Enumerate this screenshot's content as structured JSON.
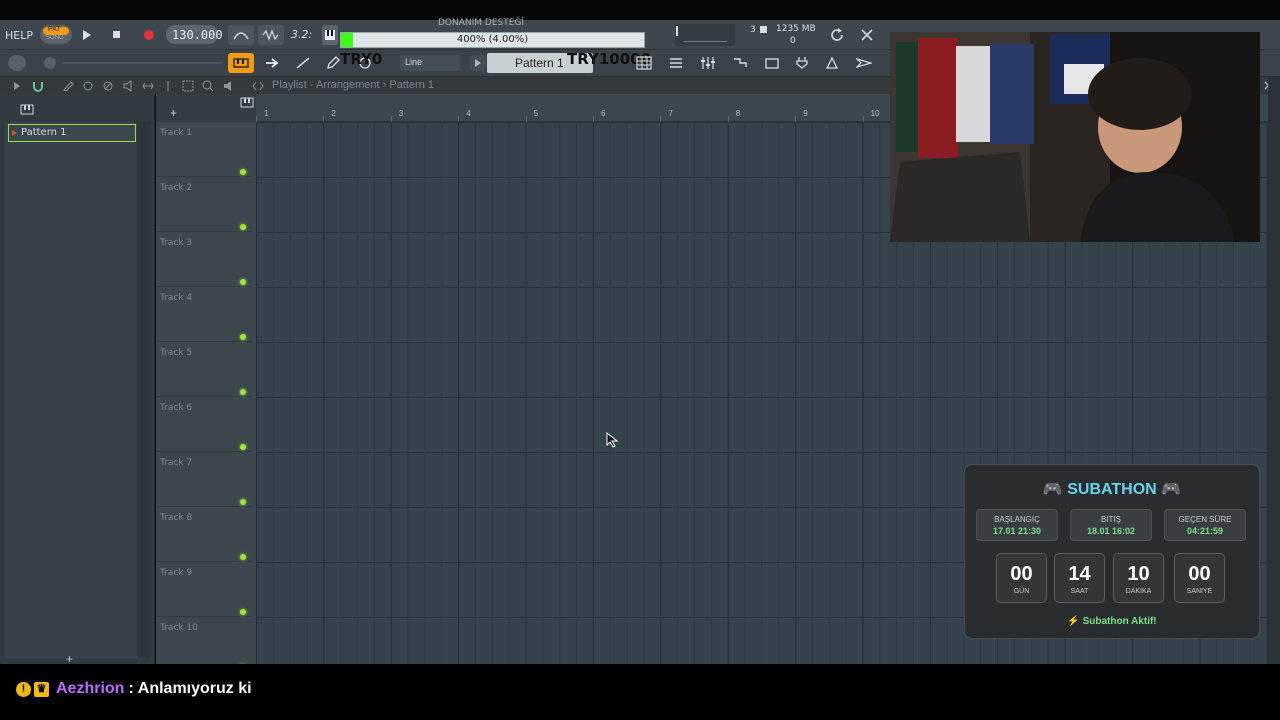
{
  "toolbar": {
    "help_label": "HELP",
    "pat_label": "PAT",
    "song_label": "SONG",
    "tempo": "130.000",
    "hint_top": "DONANIM DESTEĞİ",
    "hint_text": "400% (4.00%)",
    "hint_progress_pct": 4,
    "overlay_left": "TRY0",
    "overlay_right": "TRY10000",
    "snap_mode": "Line",
    "pattern_name": "Pattern 1",
    "cpu_voices": "3",
    "memory": "1235 MB",
    "memory_sub": "0",
    "numpad_label": "3.2:"
  },
  "playlist": {
    "breadcrumb": "Playlist · Arrangement › Pattern 1",
    "picker_items": [
      "Pattern 1"
    ],
    "tracks": [
      "Track 1",
      "Track 2",
      "Track 3",
      "Track 4",
      "Track 5",
      "Track 6",
      "Track 7",
      "Track 8",
      "Track 9",
      "Track 10"
    ],
    "bars": [
      "1",
      "2",
      "3",
      "4",
      "5",
      "6",
      "7",
      "8",
      "9",
      "10"
    ]
  },
  "subathon": {
    "title": "SUBATHON",
    "start_label": "BAŞLANGIÇ",
    "start_value": "17.01 21:30",
    "end_label": "BITIŞ",
    "end_value": "18.01 16:02",
    "elapsed_label": "GEÇEN SÜRE",
    "elapsed_value": "04:21:59",
    "countdown": [
      {
        "value": "00",
        "unit": "GÜN"
      },
      {
        "value": "14",
        "unit": "SAAT"
      },
      {
        "value": "10",
        "unit": "DAKIKA"
      },
      {
        "value": "00",
        "unit": "SANIYE"
      }
    ],
    "footer": "⚡ Subathon Aktif!",
    "accent_color": "#6ad3e6",
    "good_color": "#7ce08a"
  },
  "chat": {
    "username": "Aezhrion",
    "message": "Anlamıyoruz ki",
    "username_color": "#b96cff"
  }
}
